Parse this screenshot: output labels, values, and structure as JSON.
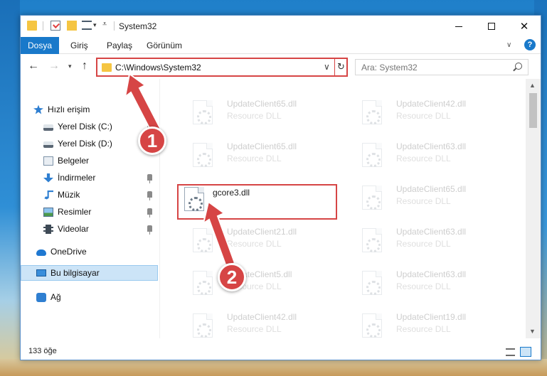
{
  "window": {
    "title": "System32",
    "minimize_glyph": "",
    "close_glyph": "✕"
  },
  "ribbon": {
    "file": "Dosya",
    "home": "Giriş",
    "share": "Paylaş",
    "view": "Görünüm",
    "help": "?"
  },
  "address": {
    "path": "C:\\Windows\\System32"
  },
  "search": {
    "placeholder": "Ara: System32"
  },
  "sidebar": {
    "items": [
      {
        "label": "Hızlı erişim"
      },
      {
        "label": "Yerel Disk (C:)"
      },
      {
        "label": "Yerel Disk (D:)"
      },
      {
        "label": "Belgeler"
      },
      {
        "label": "İndirmeler"
      },
      {
        "label": "Müzik"
      },
      {
        "label": "Resimler"
      },
      {
        "label": "Videolar"
      },
      {
        "label": "OneDrive"
      },
      {
        "label": "Bu bilgisayar"
      },
      {
        "label": "Ağ"
      }
    ]
  },
  "files": {
    "left": [
      {
        "name": "UpdateClient65.dll",
        "type": "Resource DLL"
      },
      {
        "name": "UpdateClient65.dll",
        "type": "Resource DLL"
      },
      {
        "name": "gcore3.dll",
        "type": ""
      },
      {
        "name": "UpdateClient21.dll",
        "type": "Resource DLL"
      },
      {
        "name": "UpdateClient5.dll",
        "type": "Resource DLL"
      },
      {
        "name": "UpdateClient42.dll",
        "type": "Resource DLL"
      }
    ],
    "right": [
      {
        "name": "UpdateClient42.dll",
        "type": "Resource DLL"
      },
      {
        "name": "UpdateClient63.dll",
        "type": "Resource DLL"
      },
      {
        "name": "UpdateClient65.dll",
        "type": "Resource DLL"
      },
      {
        "name": "UpdateClient63.dll",
        "type": "Resource DLL"
      },
      {
        "name": "UpdateClient63.dll",
        "type": "Resource DLL"
      },
      {
        "name": "UpdateClient19.dll",
        "type": "Resource DLL"
      }
    ]
  },
  "status": {
    "count": "133 öğe"
  },
  "callouts": {
    "one": "1",
    "two": "2"
  },
  "colors": {
    "accent": "#1979ca",
    "highlight": "#d64545"
  }
}
